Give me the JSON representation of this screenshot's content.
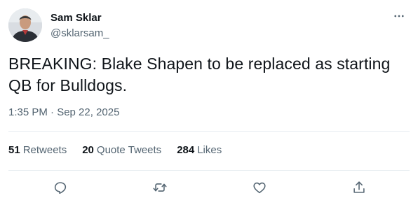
{
  "author": {
    "display_name": "Sam Sklar",
    "handle": "@sklarsam_"
  },
  "tweet": {
    "text": "BREAKING: Blake Shapen to be replaced as starting QB for Bulldogs.",
    "timestamp": "1:35 PM · Sep 22, 2025"
  },
  "stats": [
    {
      "count": "51",
      "label": "Retweets"
    },
    {
      "count": "20",
      "label": "Quote Tweets"
    },
    {
      "count": "284",
      "label": "Likes"
    }
  ],
  "actions": [
    {
      "icon": "reply-icon"
    },
    {
      "icon": "retweet-icon"
    },
    {
      "icon": "like-icon"
    },
    {
      "icon": "share-icon"
    }
  ],
  "colors": {
    "text_primary": "#0f1419",
    "text_secondary": "#536471",
    "divider": "#e6ecf0"
  }
}
